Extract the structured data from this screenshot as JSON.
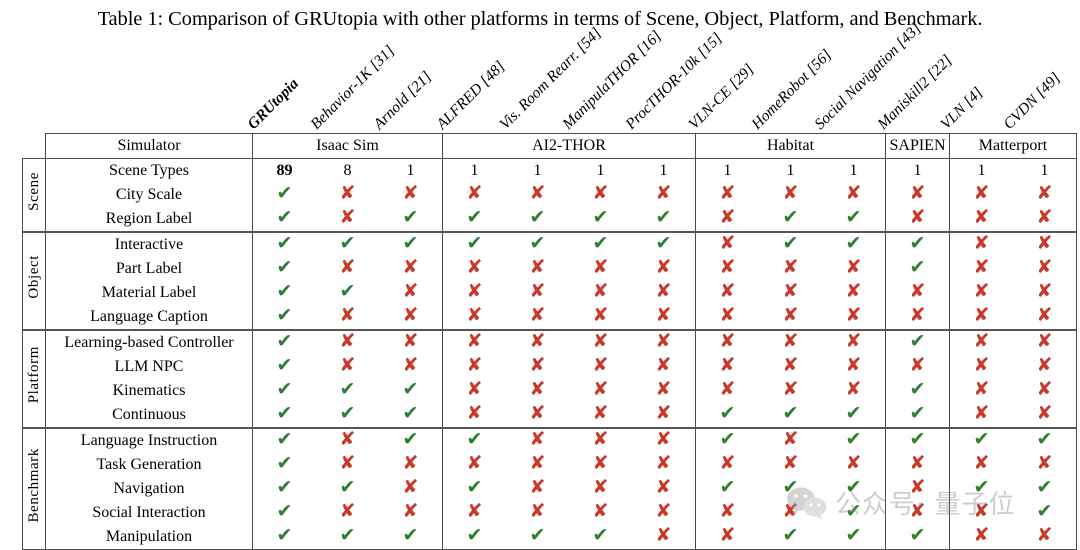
{
  "caption": "Table 1: Comparison of GRUtopia with other platforms in terms of Scene, Object, Platform, and Benchmark.",
  "table": {
    "corner_label": "Simulator",
    "columns": [
      "GRUtopia",
      "Behavior-1K [31]",
      "Arnold [21]",
      "ALFRED [48]",
      "Vis. Room Rearr. [54]",
      "ManipulaTHOR [16]",
      "ProcTHOR-10k [15]",
      "VLN-CE [29]",
      "HomeRobot [56]",
      "Social Navigation [43]",
      "Maniskill2 [22]",
      "VLN [4]",
      "CVDN [49]"
    ],
    "simulator_groups": [
      {
        "label": "Isaac Sim",
        "span": 3
      },
      {
        "label": "AI2-THOR",
        "span": 4
      },
      {
        "label": "Habitat",
        "span": 3
      },
      {
        "label": "SAPIEN",
        "span": 1
      },
      {
        "label": "Matterport",
        "span": 2
      }
    ],
    "sections": [
      {
        "name": "Scene",
        "rows": [
          {
            "label": "Scene Types",
            "type": "number",
            "values": [
              "89",
              "8",
              "1",
              "1",
              "1",
              "1",
              "1",
              "1",
              "1",
              "1",
              "1",
              "1",
              "1"
            ]
          },
          {
            "label": "City Scale",
            "type": "mark",
            "values": [
              "yes",
              "no",
              "no",
              "no",
              "no",
              "no",
              "no",
              "no",
              "no",
              "no",
              "no",
              "no",
              "no"
            ]
          },
          {
            "label": "Region Label",
            "type": "mark",
            "values": [
              "yes",
              "no",
              "yes",
              "yes",
              "yes",
              "yes",
              "yes",
              "no",
              "yes",
              "yes",
              "no",
              "no",
              "no"
            ]
          }
        ]
      },
      {
        "name": "Object",
        "rows": [
          {
            "label": "Interactive",
            "type": "mark",
            "values": [
              "yes",
              "yes",
              "yes",
              "yes",
              "yes",
              "yes",
              "yes",
              "no",
              "yes",
              "yes",
              "yes",
              "no",
              "no"
            ]
          },
          {
            "label": "Part Label",
            "type": "mark",
            "values": [
              "yes",
              "no",
              "no",
              "no",
              "no",
              "no",
              "no",
              "no",
              "no",
              "no",
              "yes",
              "no",
              "no"
            ]
          },
          {
            "label": "Material Label",
            "type": "mark",
            "values": [
              "yes",
              "yes",
              "no",
              "no",
              "no",
              "no",
              "no",
              "no",
              "no",
              "no",
              "no",
              "no",
              "no"
            ]
          },
          {
            "label": "Language Caption",
            "type": "mark",
            "values": [
              "yes",
              "no",
              "no",
              "no",
              "no",
              "no",
              "no",
              "no",
              "no",
              "no",
              "no",
              "no",
              "no"
            ]
          }
        ]
      },
      {
        "name": "Platform",
        "rows": [
          {
            "label": "Learning-based Controller",
            "type": "mark",
            "values": [
              "yes",
              "no",
              "no",
              "no",
              "no",
              "no",
              "no",
              "no",
              "no",
              "no",
              "yes",
              "no",
              "no"
            ]
          },
          {
            "label": "LLM NPC",
            "type": "mark",
            "values": [
              "yes",
              "no",
              "no",
              "no",
              "no",
              "no",
              "no",
              "no",
              "no",
              "no",
              "no",
              "no",
              "no"
            ]
          },
          {
            "label": "Kinematics",
            "type": "mark",
            "values": [
              "yes",
              "yes",
              "yes",
              "no",
              "no",
              "no",
              "no",
              "no",
              "no",
              "no",
              "yes",
              "no",
              "no"
            ]
          },
          {
            "label": "Continuous",
            "type": "mark",
            "values": [
              "yes",
              "yes",
              "yes",
              "no",
              "no",
              "no",
              "no",
              "yes",
              "yes",
              "yes",
              "yes",
              "no",
              "no"
            ]
          }
        ]
      },
      {
        "name": "Benchmark",
        "rows": [
          {
            "label": "Language Instruction",
            "type": "mark",
            "values": [
              "yes",
              "no",
              "yes",
              "yes",
              "no",
              "no",
              "no",
              "yes",
              "no",
              "yes",
              "yes",
              "yes",
              "yes"
            ]
          },
          {
            "label": "Task Generation",
            "type": "mark",
            "values": [
              "yes",
              "no",
              "no",
              "no",
              "no",
              "no",
              "no",
              "no",
              "no",
              "no",
              "no",
              "no",
              "no"
            ]
          },
          {
            "label": "Navigation",
            "type": "mark",
            "values": [
              "yes",
              "yes",
              "no",
              "yes",
              "no",
              "no",
              "no",
              "yes",
              "yes",
              "yes",
              "no",
              "yes",
              "yes"
            ]
          },
          {
            "label": "Social Interaction",
            "type": "mark",
            "values": [
              "yes",
              "no",
              "no",
              "no",
              "no",
              "no",
              "no",
              "no",
              "no",
              "yes",
              "no",
              "no",
              "yes"
            ]
          },
          {
            "label": "Manipulation",
            "type": "mark",
            "values": [
              "yes",
              "yes",
              "yes",
              "yes",
              "yes",
              "yes",
              "no",
              "no",
              "yes",
              "yes",
              "yes",
              "no",
              "no"
            ]
          }
        ]
      }
    ]
  },
  "marks": {
    "yes_glyph": "✔",
    "no_glyph": "✘",
    "yes_color": "#2f7d32",
    "no_color": "#c8392b"
  },
  "watermark": {
    "icon": "wechat-icon",
    "text": "公众号· 量子位"
  }
}
